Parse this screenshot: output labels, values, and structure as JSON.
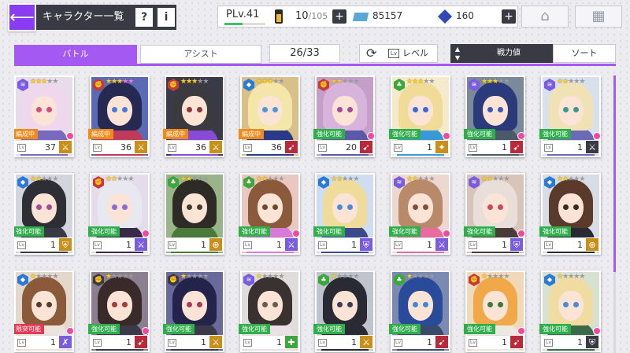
{
  "header": {
    "back_icon": "arrow-left-icon",
    "title": "キャラクター一覧",
    "help_label": "?",
    "info_label": "i",
    "player_level": "PLv.41",
    "level_progress": 0.45,
    "stamina_current": "10",
    "stamina_max": "/105",
    "stamina_plus": "+",
    "money": "85157",
    "gems": "160",
    "gems_plus": "+",
    "home_icon": "home-icon",
    "menu_icon": "grid-menu-icon"
  },
  "toolbar": {
    "tab_battle": "バトル",
    "tab_assist": "アシスト",
    "count": "26/33",
    "refresh_icon": "refresh-icon",
    "level_icon_label": "Lv",
    "level_label": "レベル",
    "sort_arrow_up": "▲",
    "sort_arrow_down": "▼",
    "sort_field": "戦力値",
    "sort_button": "ソート"
  },
  "colors": {
    "accent": "#a45af2",
    "formation": "#f08a18",
    "enhance": "#2fae4b",
    "limit": "#e23a56"
  },
  "cards": [
    {
      "element": "wind",
      "elem_color": "#7a5ce0",
      "stars": [
        1,
        1,
        1,
        0,
        0
      ],
      "badge": "編成中",
      "badge_type": "form",
      "level": "37",
      "role": "sword",
      "role_color": "#c8901a",
      "pin": true,
      "hair": "#efd8ee",
      "eye": "#d84a80",
      "outfit": "#7a6abf",
      "bg": "#e8dcea"
    },
    {
      "element": "fire",
      "elem_color": "#c83a3a",
      "stars": [
        1,
        1,
        1,
        2,
        2
      ],
      "badge": "編成中",
      "badge_type": "form",
      "level": "36",
      "role": "sword",
      "role_color": "#c8901a",
      "pin": false,
      "hair": "#262a52",
      "eye": "#4a7ad8",
      "outfit": "#c03a5a",
      "bg": "#5a6ab4"
    },
    {
      "element": "fire",
      "elem_color": "#c83a3a",
      "stars": [
        1,
        1,
        1,
        0,
        0
      ],
      "badge": "編成中",
      "badge_type": "form",
      "level": "36",
      "role": "sword",
      "role_color": "#c8901a",
      "pin": false,
      "hair": "#3a3a40",
      "eye": "#8a3a3a",
      "outfit": "#8a4ad8",
      "bg": "#3a3a48"
    },
    {
      "element": "water",
      "elem_color": "#2a7ad8",
      "stars": [
        1,
        1,
        1,
        0,
        0
      ],
      "badge": "編成中",
      "badge_type": "form",
      "level": "36",
      "role": "shoot",
      "role_color": "#b82a3a",
      "pin": false,
      "hair": "#f3e6a8",
      "eye": "#4a9ad8",
      "outfit": "#2a3a8a",
      "bg": "#d8c088"
    },
    {
      "element": "fire",
      "elem_color": "#c83a3a",
      "stars": [
        1,
        1,
        0,
        0,
        0
      ],
      "badge": "強化可能",
      "badge_type": "enh",
      "level": "20",
      "role": "shoot",
      "role_color": "#b82a3a",
      "pin": true,
      "hair": "#d8b4dc",
      "eye": "#a84a9a",
      "outfit": "#5a5aa8",
      "bg": "#c4a0c8"
    },
    {
      "element": "earth",
      "elem_color": "#3aa83a",
      "stars": [
        1,
        1,
        1,
        0,
        0
      ],
      "badge": "強化可能",
      "badge_type": "enh",
      "level": "1",
      "role": "support",
      "role_color": "#c8901a",
      "pin": true,
      "hair": "#f0dc98",
      "eye": "#3a6ad8",
      "outfit": "#3a9ad8",
      "bg": "#f4eacc"
    },
    {
      "element": "wind",
      "elem_color": "#7a5ce0",
      "stars": [
        1,
        1,
        1,
        0,
        0
      ],
      "badge": "強化可能",
      "badge_type": "enh",
      "level": "1",
      "role": "shoot",
      "role_color": "#b82a3a",
      "pin": true,
      "hair": "#2a3a7a",
      "eye": "#3a5ab8",
      "outfit": "#4a5a6a",
      "bg": "#7a8a9a"
    },
    {
      "element": "wind",
      "elem_color": "#7a5ce0",
      "stars": [
        1,
        1,
        0,
        0,
        0
      ],
      "badge": "強化可能",
      "badge_type": "enh",
      "level": "1",
      "role": "sword",
      "role_color": "#3a3a44",
      "pin": true,
      "hair": "#f0e2b4",
      "eye": "#3a9a8a",
      "outfit": "#6a6ab8",
      "bg": "#d8e0ec"
    },
    {
      "element": "water",
      "elem_color": "#2a7ad8",
      "stars": [
        1,
        1,
        0,
        0,
        0
      ],
      "badge": "強化可能",
      "badge_type": "enh",
      "level": "1",
      "role": "defend",
      "role_color": "#c8901a",
      "pin": false,
      "hair": "#2e2e36",
      "eye": "#a84a9a",
      "outfit": "#3a3a44",
      "bg": "#d4d4dc"
    },
    {
      "element": "fire",
      "elem_color": "#c83a3a",
      "stars": [
        1,
        1,
        0,
        0,
        0
      ],
      "badge": "強化可能",
      "badge_type": "enh",
      "level": "1",
      "role": "sword",
      "role_color": "#7a5ce0",
      "pin": true,
      "hair": "#e8e8f0",
      "eye": "#8a6ad8",
      "outfit": "#3a2a4a",
      "bg": "#e4dcea"
    },
    {
      "element": "earth",
      "elem_color": "#3aa83a",
      "stars": [
        1,
        1,
        0,
        0,
        0
      ],
      "badge": "",
      "badge_type": "",
      "level": "1",
      "role": "target",
      "role_color": "#c8901a",
      "pin": false,
      "hair": "#2e2a26",
      "eye": "#4a3a2a",
      "outfit": "#4a7a3a",
      "bg": "#9ab48a"
    },
    {
      "element": "earth",
      "elem_color": "#3aa83a",
      "stars": [
        1,
        1,
        0,
        0,
        0
      ],
      "badge": "強化可能",
      "badge_type": "enh",
      "level": "1",
      "role": "sword",
      "role_color": "#7a5ce0",
      "pin": true,
      "hair": "#8a5a3a",
      "eye": "#6a4a2a",
      "outfit": "#d87ad8",
      "bg": "#e8c8c0"
    },
    {
      "element": "water",
      "elem_color": "#2a7ad8",
      "stars": [
        1,
        1,
        0,
        0,
        0
      ],
      "badge": "強化可能",
      "badge_type": "enh",
      "level": "1",
      "role": "defend",
      "role_color": "#7a5ce0",
      "pin": false,
      "hair": "#f0dc9a",
      "eye": "#4a8ad8",
      "outfit": "#3a4a8a",
      "bg": "#d0dcf0"
    },
    {
      "element": "wind",
      "elem_color": "#7a5ce0",
      "stars": [
        1,
        1,
        0,
        0,
        0
      ],
      "badge": "強化可能",
      "badge_type": "enh",
      "level": "1",
      "role": "sword",
      "role_color": "#7a5ce0",
      "pin": true,
      "hair": "#b88a6a",
      "eye": "#8a4a3a",
      "outfit": "#e86aa0",
      "bg": "#ecd8d0"
    },
    {
      "element": "wind",
      "elem_color": "#7a5ce0",
      "stars": [
        1,
        1,
        0,
        0,
        0
      ],
      "badge": "強化可能",
      "badge_type": "enh",
      "level": "1",
      "role": "defend",
      "role_color": "#7a5ce0",
      "pin": true,
      "hair": "#e8e0d8",
      "eye": "#c84a5a",
      "outfit": "#4a3a3a",
      "bg": "#d8c4b8"
    },
    {
      "element": "water",
      "elem_color": "#2a7ad8",
      "stars": [
        1,
        1,
        0,
        0,
        0
      ],
      "badge": "強化可能",
      "badge_type": "enh",
      "level": "1",
      "role": "target",
      "role_color": "#c8901a",
      "pin": false,
      "hair": "#5a3a2a",
      "eye": "#3a2a1a",
      "outfit": "#2a2a34",
      "bg": "#d8dce4"
    },
    {
      "element": "water",
      "elem_color": "#2a7ad8",
      "stars": [
        1,
        0,
        0,
        0,
        0
      ],
      "badge": "限突可能",
      "badge_type": "lim",
      "level": "1",
      "role": "snipe",
      "role_color": "#7a5ce0",
      "pin": true,
      "hair": "#8a5a3a",
      "eye": "#5a3a2a",
      "outfit": "#ece4dc",
      "bg": "#e4d8cc"
    },
    {
      "element": "fire",
      "elem_color": "#3a3a44",
      "stars": [
        1,
        0,
        0,
        0,
        0
      ],
      "badge": "強化可能",
      "badge_type": "enh",
      "level": "1",
      "role": "shoot",
      "role_color": "#b82a3a",
      "pin": true,
      "hair": "#3a2a2a",
      "eye": "#a83a3a",
      "outfit": "#3a3a4a",
      "bg": "#8a8090"
    },
    {
      "element": "fire",
      "elem_color": "#3a3a44",
      "stars": [
        1,
        0,
        0,
        0,
        0
      ],
      "badge": "強化可能",
      "badge_type": "enh",
      "level": "1",
      "role": "sword",
      "role_color": "#c8901a",
      "pin": false,
      "hair": "#24244a",
      "eye": "#a83a5a",
      "outfit": "#3a3a4a",
      "bg": "#6a6a9a"
    },
    {
      "element": "wind",
      "elem_color": "#7a5ce0",
      "stars": [
        1,
        0,
        0,
        0,
        0
      ],
      "badge": "強化可能",
      "badge_type": "enh",
      "level": "1",
      "role": "heal",
      "role_color": "#3aa83a",
      "pin": false,
      "hair": "#3a3230",
      "eye": "#6a5a4a",
      "outfit": "#ece0e4",
      "bg": "#e0dcdc"
    },
    {
      "element": "earth",
      "elem_color": "#3aa83a",
      "stars": [
        1,
        0,
        0,
        0,
        0
      ],
      "badge": "強化可能",
      "badge_type": "enh",
      "level": "1",
      "role": "sword",
      "role_color": "#c8901a",
      "pin": false,
      "hair": "#2a2a34",
      "eye": "#3a3a5a",
      "outfit": "#2a2a34",
      "bg": "#c0c4cc"
    },
    {
      "element": "earth",
      "elem_color": "#3aa83a",
      "stars": [
        1,
        0,
        0,
        0,
        0
      ],
      "badge": "強化可能",
      "badge_type": "enh",
      "level": "1",
      "role": "shoot",
      "role_color": "#b82a3a",
      "pin": false,
      "hair": "#2a4a9a",
      "eye": "#3a8ad8",
      "outfit": "#3a4a6a",
      "bg": "#7a8ab0"
    },
    {
      "element": "fire",
      "elem_color": "#c83a3a",
      "stars": [
        1,
        0,
        0,
        0,
        0
      ],
      "badge": "強化可能",
      "badge_type": "enh",
      "level": "1",
      "role": "shoot",
      "role_color": "#b82a3a",
      "pin": true,
      "hair": "#f0a848",
      "eye": "#3a7a3a",
      "outfit": "#ece8e0",
      "bg": "#f0d8b8"
    },
    {
      "element": "water",
      "elem_color": "#2a7ad8",
      "stars": [
        1,
        0,
        0,
        0,
        0
      ],
      "badge": "強化可能",
      "badge_type": "enh",
      "level": "1",
      "role": "defend",
      "role_color": "#3a3a44",
      "pin": true,
      "hair": "#f0dca0",
      "eye": "#4a8ad8",
      "outfit": "#3a6a4a",
      "bg": "#d8e0d0"
    }
  ]
}
